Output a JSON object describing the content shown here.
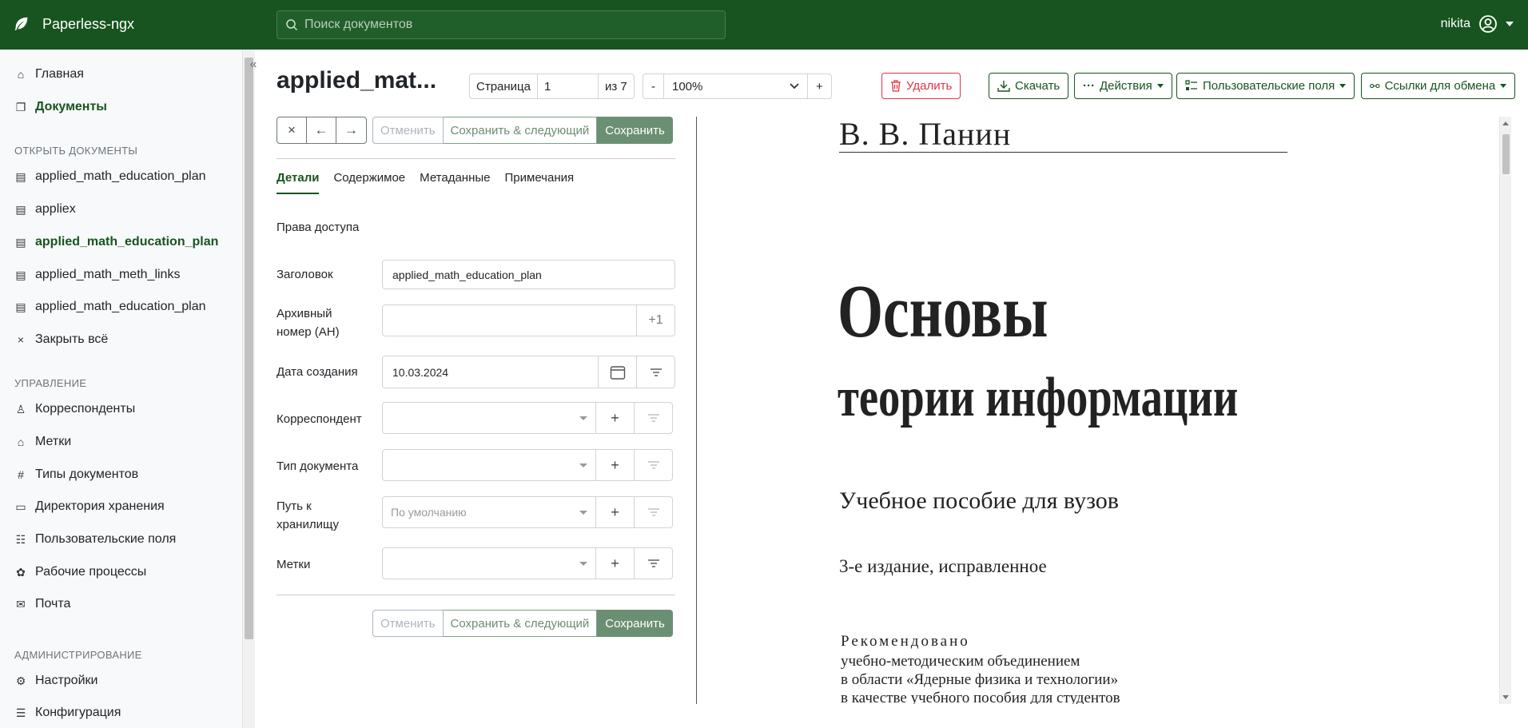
{
  "app": {
    "name": "Paperless-ngx"
  },
  "search": {
    "placeholder": "Поиск документов"
  },
  "user": {
    "name": "nikita"
  },
  "sidebar": {
    "home": "Главная",
    "documents": "Документы",
    "open_docs_header": "ОТКРЫТЬ ДОКУМЕНТЫ",
    "open_docs": [
      "applied_math_education_plan",
      "appliex",
      "applied_math_education_plan",
      "applied_math_meth_links",
      "applied_math_education_plan"
    ],
    "close_all": "Закрыть всё",
    "manage_header": "УПРАВЛЕНИЕ",
    "manage": [
      "Корреспонденты",
      "Метки",
      "Типы документов",
      "Директория хранения",
      "Пользовательские поля",
      "Рабочие процессы",
      "Почта"
    ],
    "admin_header": "АДМИНИСТРИРОВАНИЕ",
    "admin": [
      "Настройки",
      "Конфигурация"
    ]
  },
  "doc": {
    "title": "applied_mat...",
    "page_label": "Страница",
    "page": "1",
    "page_of": "из 7",
    "zoom_minus": "-",
    "zoom": "100%",
    "zoom_plus": "+"
  },
  "actions": {
    "delete": "Удалить",
    "download": "Скачать",
    "actions": "Действия",
    "custom_fields": "Пользовательские поля",
    "share_links": "Ссылки для обмена"
  },
  "toolbar": {
    "close": "×",
    "prev": "←",
    "next": "→",
    "cancel": "Отменить",
    "save_next": "Сохранить & следующий",
    "save": "Сохранить"
  },
  "tabs": [
    "Детали",
    "Содержимое",
    "Метаданные",
    "Примечания"
  ],
  "form": {
    "permissions": "Права доступа",
    "title_label": "Заголовок",
    "title_value": "applied_math_education_plan",
    "asn_label": "Архивный номер (АН)",
    "asn_value": "",
    "asn_plus": "+1",
    "created_label": "Дата создания",
    "created_value": "10.03.2024",
    "correspondent_label": "Корреспондент",
    "doctype_label": "Тип документа",
    "storage_label": "Путь к хранилищу",
    "storage_placeholder": "По умолчанию",
    "tags_label": "Метки",
    "add": "+"
  },
  "preview": {
    "author": "В. В. Панин",
    "title1": "Основы",
    "title2": "теории информации",
    "subtitle": "Учебное пособие для вузов",
    "edition": "3-е издание, исправленное",
    "rec_head": "Рекомендовано",
    "rec_lines": [
      "учебно-методическим объединением",
      "в области «Ядерные физика и технологии»",
      "в качестве учебного пособия для студентов"
    ]
  }
}
